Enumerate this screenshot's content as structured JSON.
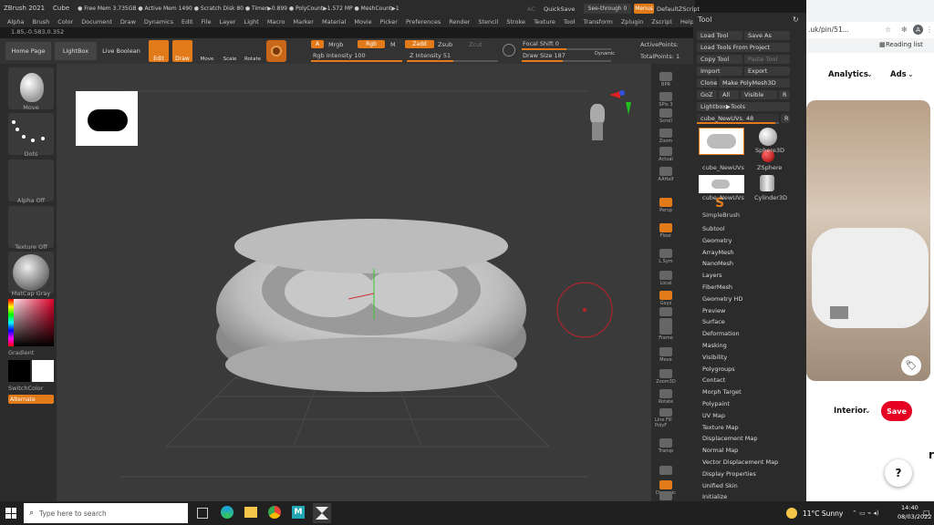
{
  "titlebar": {
    "app": "ZBrush 2021",
    "doc": "Cube",
    "mem": "● Free Mem 3.735GB ● Active Mem 1490 ● Scratch Disk 80 ● Timer▶0.899 ● PolyCount▶1.572 MP ● MeshCount▶1",
    "ac": "AC",
    "quicksave": "QuickSave",
    "seethrough": "See-through  0",
    "menus": "Menus",
    "script": "DefaultZScript"
  },
  "menubar": [
    "Alpha",
    "Brush",
    "Color",
    "Document",
    "Draw",
    "Dynamics",
    "Edit",
    "File",
    "Layer",
    "Light",
    "Macro",
    "Marker",
    "Material",
    "Movie",
    "Picker",
    "Preferences",
    "Render",
    "Stencil",
    "Stroke",
    "Texture",
    "Tool",
    "Transform",
    "Zplugin",
    "Zscript",
    "Help"
  ],
  "coords": "1.85,-0.583,0.352",
  "topshelf": {
    "home": "Home Page",
    "lightbox": "LightBox",
    "liveboolean": "Live Boolean",
    "edit": "Edit",
    "draw": "Draw",
    "move": "Move",
    "scale": "Scale",
    "rotate": "Rotate",
    "a": "A",
    "mrgb": "Mrgb",
    "rgb": "Rgb",
    "m": "M",
    "zadd": "Zadd",
    "zsub": "Zsub",
    "zcut": "Zcut",
    "rgbintensity": "Rgb Intensity 100",
    "zintensity": "Z Intensity 51",
    "focalshift": "Focal Shift 0",
    "drawsize": "Draw Size 187",
    "dynamic": "Dynamic",
    "activepoints": "ActivePoints:",
    "totalpoints": "TotalPoints: 1"
  },
  "leftshelf": {
    "brush": "Move",
    "stroke": "Dots",
    "alpha": "Alpha Off",
    "texture": "Texture Off",
    "material": "MatCap Gray",
    "gradient": "Gradient",
    "switchcolor": "SwitchColor",
    "alternate": "Alternate"
  },
  "rightshelf": [
    "BPR",
    "SPix 3",
    "Scroll",
    "Zoom",
    "Actual",
    "AAHalf",
    "Persp",
    "Floor",
    "L.Sym",
    "Local",
    "Gxyz",
    "",
    "",
    "Frame",
    "Move",
    "Zoom3D",
    "Rotate",
    "Line Fill PolyF",
    "Transp",
    "",
    "Dynamic",
    "Solo"
  ],
  "toolpanel": {
    "title": "Tool",
    "loadtool": "Load Tool",
    "saveas": "Save As",
    "loadfromproject": "Load Tools From Project",
    "copytool": "Copy Tool",
    "pastetool": "Paste Tool",
    "import": "Import",
    "export": "Export",
    "clone": "Clone",
    "makepolymesh": "Make PolyMesh3D",
    "goz": "GoZ",
    "all": "All",
    "visible": "Visible",
    "r": "R",
    "lightboxtools": "Lightbox▶Tools",
    "toolname": "cube_NewUVs. 48",
    "r2": "R",
    "thumbs": [
      "cube_NewUVs",
      "Sphere3D",
      "cube_NewUVs",
      "ZSphere",
      "Cylinder3D",
      "SimpleBrush"
    ],
    "subpalettes": [
      "Subtool",
      "Geometry",
      "ArrayMesh",
      "NanoMesh",
      "Layers",
      "FiberMesh",
      "Geometry HD",
      "Preview",
      "Surface",
      "Deformation",
      "Masking",
      "Visibility",
      "Polygroups",
      "Contact",
      "Morph Target",
      "Polypaint",
      "UV Map",
      "Texture Map",
      "Displacement Map",
      "Normal Map",
      "Vector Displacement Map",
      "Display Properties",
      "Unified Skin",
      "Initialize"
    ]
  },
  "browser": {
    "url": ".uk/pin/51...",
    "readinglist": "Reading list",
    "nav1": "Analytics",
    "nav2": "Ads",
    "category": "Interior",
    "save": "Save",
    "help": "?",
    "avatar": "A"
  },
  "taskbar": {
    "search": "Type here to search",
    "weather": "11°C  Sunny",
    "time": "14:40",
    "date": "08/03/2022"
  },
  "colors": {
    "accent": "#e27a1a",
    "save": "#e60023"
  }
}
